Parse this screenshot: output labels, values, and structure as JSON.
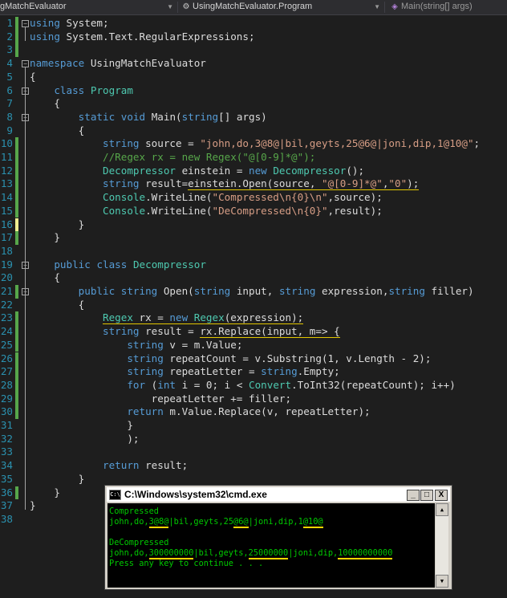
{
  "navbar": {
    "project": "gMatchEvaluator",
    "type_combo": "UsingMatchEvaluator.Program",
    "member_combo": "Main(string[] args)"
  },
  "editor": {
    "lines": [
      {
        "n": "1",
        "segs": [
          {
            "c": "k",
            "t": "using"
          },
          {
            "t": " System;"
          }
        ]
      },
      {
        "n": "2",
        "segs": [
          {
            "c": "k",
            "t": "using"
          },
          {
            "t": " System.Text.RegularExpressions;"
          }
        ]
      },
      {
        "n": "3",
        "segs": []
      },
      {
        "n": "4",
        "segs": [
          {
            "c": "k",
            "t": "namespace"
          },
          {
            "t": " UsingMatchEvaluator"
          }
        ]
      },
      {
        "n": "5",
        "segs": [
          {
            "t": "{"
          }
        ]
      },
      {
        "n": "6",
        "segs": [
          {
            "t": "    "
          },
          {
            "c": "k",
            "t": "class"
          },
          {
            "t": " "
          },
          {
            "c": "t",
            "t": "Program"
          }
        ]
      },
      {
        "n": "7",
        "segs": [
          {
            "t": "    {"
          }
        ]
      },
      {
        "n": "8",
        "segs": [
          {
            "t": "        "
          },
          {
            "c": "k",
            "t": "static"
          },
          {
            "t": " "
          },
          {
            "c": "k",
            "t": "void"
          },
          {
            "t": " Main("
          },
          {
            "c": "k",
            "t": "string"
          },
          {
            "t": "[] args)"
          }
        ]
      },
      {
        "n": "9",
        "segs": [
          {
            "t": "        {"
          }
        ]
      },
      {
        "n": "10",
        "segs": [
          {
            "t": "            "
          },
          {
            "c": "k",
            "t": "string"
          },
          {
            "t": " source = "
          },
          {
            "c": "s",
            "t": "\"john,do,3@8@|bil,geyts,25@6@|joni,dip,1@10@\""
          },
          {
            "t": ";"
          }
        ]
      },
      {
        "n": "11",
        "segs": [
          {
            "t": "            "
          },
          {
            "c": "c",
            "t": "//Regex rx = new Regex(\"@[0-9]*@\");"
          }
        ]
      },
      {
        "n": "12",
        "segs": [
          {
            "t": "            "
          },
          {
            "c": "t",
            "t": "Decompressor"
          },
          {
            "t": " einstein = "
          },
          {
            "c": "k",
            "t": "new"
          },
          {
            "t": " "
          },
          {
            "c": "t",
            "t": "Decompressor"
          },
          {
            "t": "();"
          }
        ]
      },
      {
        "n": "13",
        "segs": [
          {
            "t": "            "
          },
          {
            "c": "k",
            "t": "string"
          },
          {
            "t": " result="
          },
          {
            "u": 1,
            "t": "einstein.Open(source, "
          },
          {
            "u": 1,
            "c": "s",
            "t": "\"@[0-9]*@\""
          },
          {
            "u": 1,
            "t": ","
          },
          {
            "u": 1,
            "c": "s",
            "t": "\"0\""
          },
          {
            "u": 1,
            "t": ");"
          }
        ]
      },
      {
        "n": "14",
        "segs": [
          {
            "t": "            "
          },
          {
            "c": "t",
            "t": "Console"
          },
          {
            "t": ".WriteLine("
          },
          {
            "c": "s",
            "t": "\"Compressed\\n{0}\\n\""
          },
          {
            "t": ",source);"
          }
        ]
      },
      {
        "n": "15",
        "segs": [
          {
            "t": "            "
          },
          {
            "c": "t",
            "t": "Console"
          },
          {
            "t": ".WriteLine("
          },
          {
            "c": "s",
            "t": "\"DeCompressed\\n{0}\""
          },
          {
            "t": ",result);"
          }
        ]
      },
      {
        "n": "16",
        "segs": [
          {
            "t": "        }"
          }
        ]
      },
      {
        "n": "17",
        "segs": [
          {
            "t": "    }"
          }
        ]
      },
      {
        "n": "18",
        "segs": []
      },
      {
        "n": "19",
        "segs": [
          {
            "t": "    "
          },
          {
            "c": "k",
            "t": "public"
          },
          {
            "t": " "
          },
          {
            "c": "k",
            "t": "class"
          },
          {
            "t": " "
          },
          {
            "c": "t",
            "t": "Decompressor"
          }
        ]
      },
      {
        "n": "20",
        "segs": [
          {
            "t": "    {"
          }
        ]
      },
      {
        "n": "21",
        "segs": [
          {
            "t": "        "
          },
          {
            "c": "k",
            "t": "public"
          },
          {
            "t": " "
          },
          {
            "c": "k",
            "t": "string"
          },
          {
            "t": " Open("
          },
          {
            "c": "k",
            "t": "string"
          },
          {
            "t": " input, "
          },
          {
            "c": "k",
            "t": "string"
          },
          {
            "t": " expression,"
          },
          {
            "c": "k",
            "t": "string"
          },
          {
            "t": " filler)"
          }
        ]
      },
      {
        "n": "22",
        "segs": [
          {
            "t": "        {"
          }
        ]
      },
      {
        "n": "23",
        "segs": [
          {
            "t": "            "
          },
          {
            "u": 1,
            "c": "t",
            "t": "Regex"
          },
          {
            "u": 1,
            "t": " rx = "
          },
          {
            "u": 1,
            "c": "k",
            "t": "new"
          },
          {
            "u": 1,
            "t": " "
          },
          {
            "u": 1,
            "c": "t",
            "t": "Regex"
          },
          {
            "u": 1,
            "t": "(expression);"
          }
        ]
      },
      {
        "n": "24",
        "segs": [
          {
            "t": "            "
          },
          {
            "c": "k",
            "t": "string"
          },
          {
            "t": " result = "
          },
          {
            "u": 1,
            "t": "rx.Replace(input, m=> {"
          }
        ]
      },
      {
        "n": "25",
        "segs": [
          {
            "t": "                "
          },
          {
            "c": "k",
            "t": "string"
          },
          {
            "t": " v = m.Value;"
          }
        ]
      },
      {
        "n": "26",
        "segs": [
          {
            "t": "                "
          },
          {
            "c": "k",
            "t": "string"
          },
          {
            "t": " repeatCount = v.Substring(1, v.Length - 2);"
          }
        ]
      },
      {
        "n": "27",
        "segs": [
          {
            "t": "                "
          },
          {
            "c": "k",
            "t": "string"
          },
          {
            "t": " repeatLetter = "
          },
          {
            "c": "k",
            "t": "string"
          },
          {
            "t": ".Empty;"
          }
        ]
      },
      {
        "n": "28",
        "segs": [
          {
            "t": "                "
          },
          {
            "c": "k",
            "t": "for"
          },
          {
            "t": " ("
          },
          {
            "c": "k",
            "t": "int"
          },
          {
            "t": " i = 0; i < "
          },
          {
            "c": "t",
            "t": "Convert"
          },
          {
            "t": ".ToInt32(repeatCount); i++)"
          }
        ]
      },
      {
        "n": "29",
        "segs": [
          {
            "t": "                    repeatLetter += filler;"
          }
        ]
      },
      {
        "n": "30",
        "segs": [
          {
            "t": "                "
          },
          {
            "c": "k",
            "t": "return"
          },
          {
            "t": " m.Value.Replace(v, repeatLetter);"
          }
        ]
      },
      {
        "n": "31",
        "segs": [
          {
            "t": "                }"
          }
        ]
      },
      {
        "n": "32",
        "segs": [
          {
            "t": "                );"
          }
        ]
      },
      {
        "n": "33",
        "segs": []
      },
      {
        "n": "34",
        "segs": [
          {
            "t": "            "
          },
          {
            "c": "k",
            "t": "return"
          },
          {
            "t": " result;"
          }
        ]
      },
      {
        "n": "35",
        "segs": [
          {
            "t": "        }"
          }
        ]
      },
      {
        "n": "36",
        "segs": [
          {
            "t": "    }"
          }
        ]
      },
      {
        "n": "37",
        "segs": [
          {
            "t": "}"
          }
        ]
      },
      {
        "n": "38",
        "segs": []
      }
    ]
  },
  "console": {
    "title": "C:\\Windows\\system32\\cmd.exe",
    "icon_label": "C:\\",
    "minimize": "_",
    "maximize": "□",
    "close": "X",
    "lines": [
      {
        "segs": [
          {
            "t": "Compressed"
          }
        ]
      },
      {
        "segs": [
          {
            "t": "john,do,"
          },
          {
            "h": 1,
            "t": "3@8@"
          },
          {
            "t": "|bil,geyts,25"
          },
          {
            "h": 1,
            "t": "@6@"
          },
          {
            "t": "|joni,dip,1"
          },
          {
            "h": 1,
            "t": "@10@"
          }
        ]
      },
      {
        "segs": []
      },
      {
        "segs": [
          {
            "t": "DeCompressed"
          }
        ]
      },
      {
        "segs": [
          {
            "t": "john,do,"
          },
          {
            "h": 1,
            "t": "300000000"
          },
          {
            "t": "|bil,geyts,"
          },
          {
            "h": 1,
            "t": "25000000"
          },
          {
            "t": "|joni,dip,"
          },
          {
            "h": 1,
            "t": "10000000000"
          }
        ]
      },
      {
        "segs": [
          {
            "t": "Press any key to continue . . ."
          }
        ]
      }
    ]
  }
}
